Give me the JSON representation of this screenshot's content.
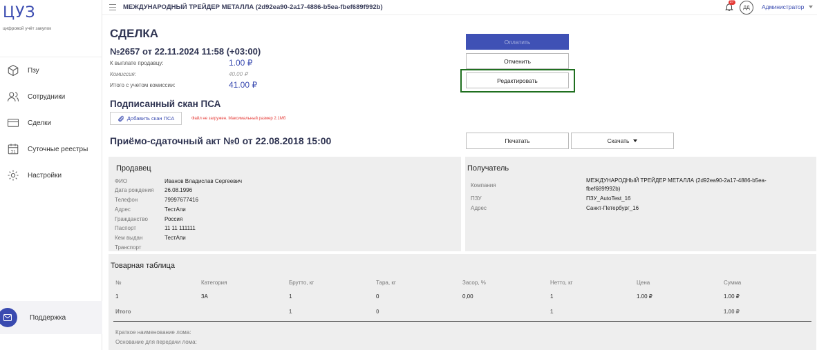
{
  "sidebar": {
    "logo": "ЦУЗ",
    "logo_sub": "цифровой учёт закупок",
    "items": [
      {
        "label": "Пзу",
        "icon": "box-icon"
      },
      {
        "label": "Сотрудники",
        "icon": "users-icon"
      },
      {
        "label": "Сделки",
        "icon": "card-icon"
      },
      {
        "label": "Суточные реестры",
        "icon": "calendar-icon"
      },
      {
        "label": "Настройки",
        "icon": "gear-icon"
      }
    ],
    "support": "Поддержка"
  },
  "header": {
    "title": "МЕЖДУНАРОДНЫЙ ТРЕЙДЕР МЕТАЛЛА (2d92ea90-2a17-4886-b5ea-fbef689f992b)",
    "notif_count": "27",
    "avatar": "ДД",
    "user": "Администратор"
  },
  "deal": {
    "heading": "СДЕЛКА",
    "number": "№2657 от 22.11.2024 11:58 (+03:00)",
    "rows": [
      {
        "label": "К выплате продавцу:",
        "value": "1.00 ₽"
      },
      {
        "label": "Комиссия:",
        "value": "40.00 ₽"
      },
      {
        "label": "Итого с учетом комиссии:",
        "value": "41.00 ₽"
      }
    ]
  },
  "actions": {
    "pay": "Оплатить",
    "cancel": "Отменить",
    "edit": "Редактировать",
    "print": "Печатать",
    "download": "Скачать"
  },
  "scan": {
    "heading": "Подписанный скан ПСА",
    "add": "Добавить скан ПСА",
    "error": "Файл не загружен. Максимальный размер 2.1Мб"
  },
  "act": {
    "heading": "Приёмо-сдаточный акт №0 от 22.08.2018 15:00"
  },
  "seller": {
    "title": "Продавец",
    "fields": [
      {
        "label": "ФИО",
        "value": "Иванов Владислав Сергеевич"
      },
      {
        "label": "Дата рождения",
        "value": "26.08.1996"
      },
      {
        "label": "Телефон",
        "value": "79997677416"
      },
      {
        "label": "Адрес",
        "value": "ТестАпи"
      },
      {
        "label": "Гражданство",
        "value": "Россия"
      },
      {
        "label": "Паспорт",
        "value": "11 11 111111"
      },
      {
        "label": "Кем выдан",
        "value": "ТестАпи"
      },
      {
        "label": "Транспорт",
        "value": ""
      }
    ]
  },
  "receiver": {
    "title": "Получатель",
    "company_label": "Компания",
    "company_line1": "МЕЖДУНАРОДНЫЙ ТРЕЙДЕР МЕТАЛЛА (2d92ea90-2a17-4886-b5ea-",
    "company_line2": "fbef689f992b)",
    "pzu_label": "ПЗУ",
    "pzu_value": "ПЗУ_AutoTest_16",
    "address_label": "Адрес",
    "address_value": "Санкт-Петербург_16"
  },
  "goods": {
    "title": "Товарная таблица",
    "columns": [
      "№",
      "Категория",
      "Брутто, кг",
      "Тара, кг",
      "Засор, %",
      "Нетто, кг",
      "Цена",
      "Сумма"
    ],
    "row": [
      "1",
      "3А",
      "1",
      "0",
      "0,00",
      "1",
      "1.00 ₽",
      "1.00 ₽"
    ],
    "total": [
      "Итого",
      "",
      "1",
      "0",
      "",
      "1",
      "",
      "1.00 ₽"
    ],
    "note1": "Краткое наименование лома:",
    "note2": "Основание для передачи лома:"
  }
}
